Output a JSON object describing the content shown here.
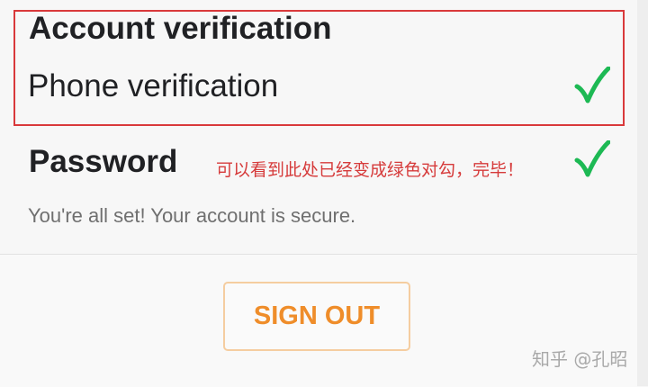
{
  "account_section": {
    "title": "Account verification",
    "phone_item_label": "Phone verification"
  },
  "password_section": {
    "title": "Password",
    "annotation": "可以看到此处已经变成绿色对勾，完毕！",
    "status_text": "You're all set! Your account is secure."
  },
  "actions": {
    "sign_out_label": "SIGN OUT"
  },
  "watermark": {
    "text": "知乎 @孔昭"
  },
  "colors": {
    "check_green": "#1db954",
    "highlight_red": "#d9393b",
    "sign_out_orange": "#ef8d2a",
    "annotation_red": "#d63b3b"
  },
  "icons": {
    "phone_status": "check-icon",
    "password_status": "check-icon"
  }
}
